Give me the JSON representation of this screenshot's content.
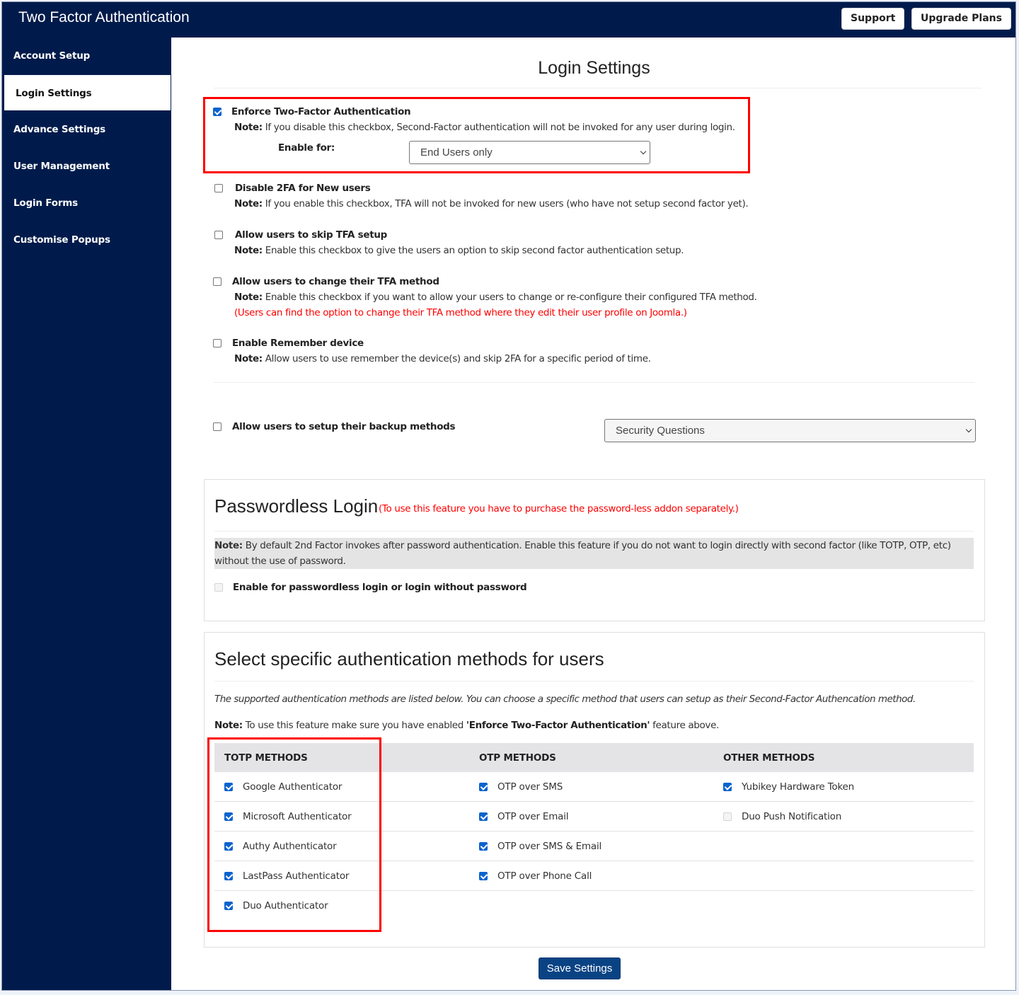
{
  "header": {
    "title": "Two Factor Authentication",
    "support_label": "Support",
    "upgrade_label": "Upgrade Plans"
  },
  "sidebar": {
    "items": [
      {
        "label": "Account Setup",
        "active": false
      },
      {
        "label": "Login Settings",
        "active": true
      },
      {
        "label": "Advance Settings",
        "active": false
      },
      {
        "label": "User Management",
        "active": false
      },
      {
        "label": "Login Forms",
        "active": false
      },
      {
        "label": "Customise Popups",
        "active": false
      }
    ]
  },
  "main": {
    "title": "Login Settings",
    "enforce": {
      "label": "Enforce Two-Factor Authentication",
      "checked": true,
      "note_prefix": "Note:",
      "note": " If you disable this checkbox, Second-Factor authentication will not be invoked for any user during login.",
      "enable_for_label": "Enable for:",
      "enable_for_value": "End Users only"
    },
    "options": [
      {
        "label": "Disable 2FA for New users",
        "checked": false,
        "note_prefix": "Note:",
        "note": "  If you enable this checkbox, TFA will not be invoked for new users (who have not setup second factor yet)."
      },
      {
        "label": "Allow users to skip TFA setup",
        "checked": false,
        "note_prefix": "Note:",
        "note": " Enable this checkbox to give the users an option to skip second factor authentication setup."
      },
      {
        "label": "Allow users to change their TFA method",
        "checked": false,
        "note_prefix": "Note:",
        "note": " Enable this checkbox if you want to allow your users to change or re-configure their configured TFA method.",
        "red_note": "(Users can find the option to change their TFA method where they edit their user profile on Joomla.)"
      },
      {
        "label": "Enable Remember device",
        "checked": false,
        "note_prefix": "Note:",
        "note": " Allow users to use remember the device(s) and skip 2FA for a specific period of time."
      }
    ],
    "backup": {
      "label": "Allow users to setup their backup methods",
      "checked": false,
      "select_value": "Security Questions"
    },
    "passwordless": {
      "title": "Passwordless Login",
      "red_note": "(To use this feature you have to purchase the password-less addon separately.)",
      "note_prefix": "Note:",
      "note": " By default 2nd Factor invokes after password authentication. Enable this feature if you do not want to login directly with second factor (like TOTP, OTP, etc) without the use of password.",
      "checkbox_label": "Enable for passwordless login or login without password",
      "checked": false,
      "disabled": true
    },
    "methods": {
      "title": "Select specific authentication methods for users",
      "intro": "The supported authentication methods are listed below. You can choose a specific method that users can setup as their Second-Factor Authencation method.",
      "note_prefix": "Note:",
      "note_before": " To use this feature make sure you have enabled ",
      "note_bold": "'Enforce Two-Factor Authentication'",
      "note_after": " feature above.",
      "columns": [
        {
          "header": "TOTP METHODS",
          "items": [
            {
              "label": "Google Authenticator",
              "checked": true
            },
            {
              "label": "Microsoft Authenticator",
              "checked": true
            },
            {
              "label": "Authy Authenticator",
              "checked": true
            },
            {
              "label": "LastPass Authenticator",
              "checked": true
            },
            {
              "label": "Duo Authenticator",
              "checked": true
            }
          ]
        },
        {
          "header": "OTP METHODS",
          "items": [
            {
              "label": "OTP over SMS",
              "checked": true
            },
            {
              "label": "OTP over Email",
              "checked": true
            },
            {
              "label": "OTP over SMS & Email",
              "checked": true
            },
            {
              "label": "OTP over Phone Call",
              "checked": true
            }
          ]
        },
        {
          "header": "OTHER METHODS",
          "items": [
            {
              "label": "Yubikey Hardware Token",
              "checked": true
            },
            {
              "label": "Duo Push Notification",
              "checked": false,
              "disabled": true
            }
          ]
        }
      ]
    },
    "save_label": "Save Settings"
  },
  "colors": {
    "navy": "#001b4b",
    "highlight_red": "#ff0000",
    "checkbox_blue": "#0b63ce",
    "save_button": "#0a4384"
  }
}
